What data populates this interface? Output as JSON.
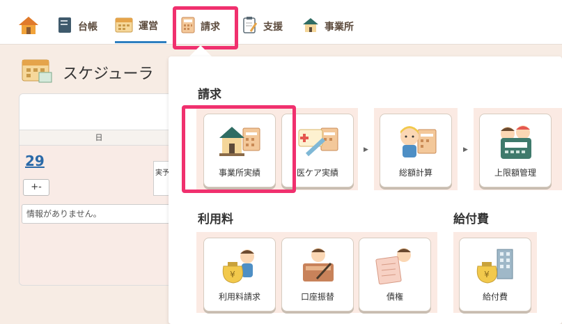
{
  "nav": {
    "items": [
      {
        "label": "",
        "icon": "home-icon"
      },
      {
        "label": "台帳",
        "icon": "ledger-book-icon"
      },
      {
        "label": "運営",
        "icon": "calendar-icon"
      },
      {
        "label": "請求",
        "icon": "calculator-icon"
      },
      {
        "label": "支援",
        "icon": "clipboard-icon"
      },
      {
        "label": "事業所",
        "icon": "office-building-icon"
      }
    ]
  },
  "scheduler": {
    "title": "スケジューラ",
    "day_of_week": "日",
    "date": "29",
    "add_label": "+-",
    "side_tag": "実予",
    "no_info": "情報がありません。"
  },
  "menu": {
    "billing": {
      "title": "請求",
      "tiles": [
        "事業所実績",
        "医ケア実績",
        "総額計算",
        "上限額管理"
      ]
    },
    "fees": {
      "title": "利用料",
      "tiles": [
        "利用料請求",
        "口座振替",
        "債権"
      ]
    },
    "benefits": {
      "title": "給付費",
      "tiles": [
        "給付費"
      ]
    }
  },
  "colors": {
    "highlight": "#f0306e",
    "accent": "#2e7fbf",
    "group_bg": "#fbeae3"
  }
}
